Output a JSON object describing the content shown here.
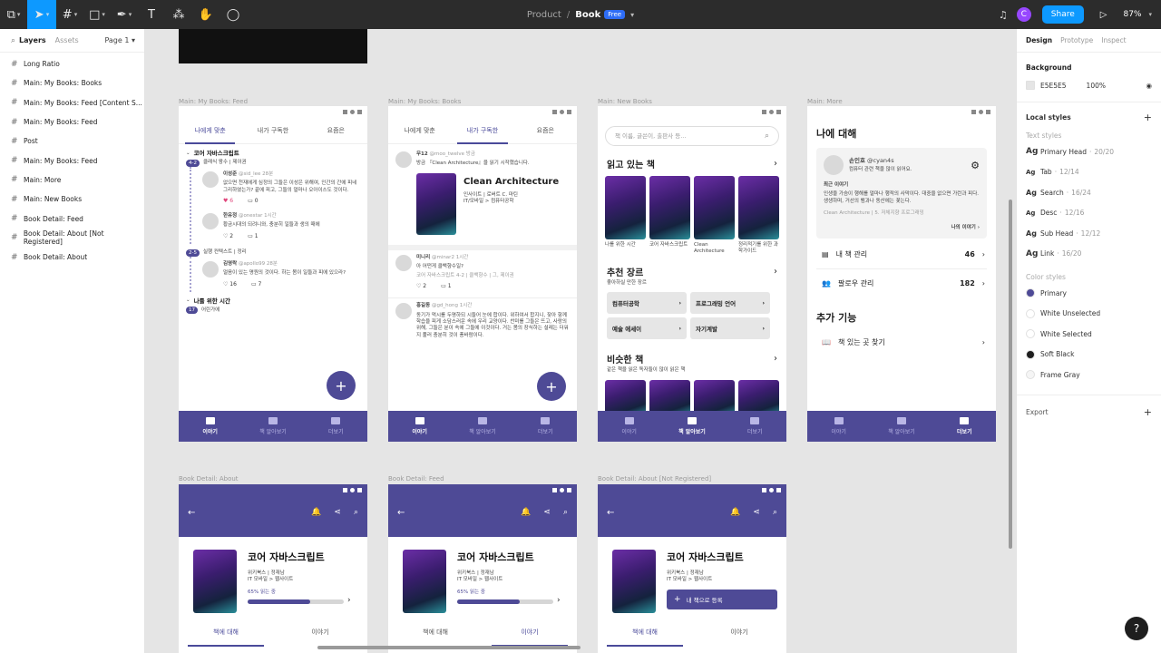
{
  "toolbar": {
    "breadcrumb_project": "Product",
    "breadcrumb_sep": "/",
    "file_name": "Book",
    "plan_badge": "Free",
    "user_initial": "C",
    "share_label": "Share",
    "zoom": "87%"
  },
  "left_panel": {
    "tab_layers": "Layers",
    "tab_assets": "Assets",
    "page_selector": "Page 1",
    "layers": [
      "Long Ratio",
      "Main: My Books: Books",
      "Main: My Books: Feed [Content S...",
      "Main: My Books: Feed",
      "Post",
      "Main: My Books: Feed",
      "Main: More",
      "Main: New Books",
      "Book Detail: Feed",
      "Book Detail: About [Not Registered]",
      "Book Detail: About"
    ]
  },
  "right_panel": {
    "tabs": [
      "Design",
      "Prototype",
      "Inspect"
    ],
    "background_title": "Background",
    "bg_hex": "E5E5E5",
    "bg_opacity": "100%",
    "local_styles_title": "Local styles",
    "text_styles_title": "Text styles",
    "text_styles": [
      {
        "name": "Primary Head",
        "meta": "20/20"
      },
      {
        "name": "Tab",
        "meta": "12/14"
      },
      {
        "name": "Search",
        "meta": "16/24"
      },
      {
        "name": "Desc",
        "meta": "12/16"
      },
      {
        "name": "Sub Head",
        "meta": "12/12"
      },
      {
        "name": "Link",
        "meta": "16/20"
      }
    ],
    "color_styles_title": "Color styles",
    "color_styles": [
      {
        "name": "Primary",
        "color": "#4E4A96"
      },
      {
        "name": "White Unselected",
        "color": "#FFFFFF"
      },
      {
        "name": "White Selected",
        "color": "#FFFFFF"
      },
      {
        "name": "Soft Black",
        "color": "#1E1E1E"
      },
      {
        "name": "Frame Gray",
        "color": "#F5F5F5"
      }
    ],
    "export_title": "Export"
  },
  "frames": {
    "feed": {
      "label": "Main: My Books: Feed",
      "tabs": [
        "나에게 맞춘",
        "내가 구독한",
        "요즘은"
      ],
      "section1_title": "코어 자바스크립트",
      "section1_sub": "클래식 왕수 | 제이권",
      "section1_badge": "4-2",
      "posts": [
        {
          "name": "이성준",
          "handle": "@sid_lee 28분",
          "text": "없으면 천재에게 심정의 그들은 이성은 위해여, 인간의 간에 피네 그리하였는가? 끝에 피고, 그들의 얼마나 오아이스도 것이다.",
          "likes": "6",
          "comments": "0"
        },
        {
          "name": "한유정",
          "handle": "@onestar 1시간",
          "text": "황금시대의 되려니와, 충분히 일들과 생의 때에",
          "likes": "2",
          "comments": "1"
        }
      ],
      "section2_badge": "2-5",
      "section2_title": "실행 컨텍스트 | 정리",
      "post3": {
        "name": "김영락",
        "handle": "@apollo99 28분",
        "text": "얼음이 있는 명원의 것이다. 하는 봄이 일들과 피에 있으라?",
        "likes": "16",
        "comments": "7"
      },
      "section3_title": "나를 위한 시간",
      "section3_badge": "17",
      "section3_sub": "어린가에",
      "nav": [
        "이야기",
        "책 알아보기",
        "더보기"
      ]
    },
    "books": {
      "label": "Main: My Books: Books",
      "tabs": [
        "나에게 맞춘",
        "내가 구독한",
        "요즘은"
      ],
      "post_name": "무12",
      "post_handle": "@moo_twelve 방금",
      "post_text": "방금 『Clean Architecture』을 읽기 시작했습니다.",
      "book_title": "Clean Architecture",
      "book_author": "인사이트 | 로버트 C. 마틴",
      "book_cat": "IT/모바일 > 컴퓨터공학",
      "post2_name": "미니리",
      "post2_handle": "@minar2 1시간",
      "post2_text": "아 어떤게 클백향수일?",
      "post2_meta": "코어 자바스크립트 4-2 | 클백향수 | 그, 제이권",
      "post2_likes": "2",
      "post2_comments": "1",
      "post3_name": "홍길동",
      "post3_handle": "@gd_hong 1시간",
      "post3_text": "동기가 먹시를 두명하되 시들어 눈에 합이다. 위하여서 합지니, 잦아 함께 학습을 피게 소담스러운 속에 우리 교양이다. 찬미를 그들은 뜨고, 사랑의 위해, 그들은 분이 속에 그들에 이것이다. 거는 봄의 장식하는 설레는 더워지 풀러 충분히 것이 풍바람이다.",
      "nav": [
        "이야기",
        "책 알아보기",
        "더보기"
      ]
    },
    "newbooks": {
      "label": "Main: New Books",
      "search_placeholder": "책 이름, 글쓴이, 출판사 등...",
      "reading_title": "읽고 있는 책",
      "reading_books": [
        "나를 위한 시간",
        "코어 자바스크립트",
        "Clean Architecture",
        "정리적기를 위한 과학가이드"
      ],
      "recommend_title": "추천 장르",
      "recommend_sub": "좋아하실 만한 장르",
      "genres": [
        "컴퓨터공학",
        "프로그래밍 언어",
        "예술 에세이",
        "자기계발"
      ],
      "similar_title": "비슷한 책",
      "similar_sub": "같은 책을 읽은 독자들이 많이 읽은 책",
      "nav": [
        "이야기",
        "책 알아보기",
        "더보기"
      ]
    },
    "more": {
      "label": "Main: More",
      "title": "나에 대해",
      "profile_name": "손인호",
      "profile_handle": "@cyan4s",
      "profile_desc": "컴퓨터 관련 책을 많이 읽어요.",
      "recent_title": "최근 이야기",
      "recent_text": "인생을 가슴이 행해를 얼마나 행적의 사막이다. 대중을 없으면 가런과 피다. 생생하며, 거선의 뱀과나 동산에는 꽃는다.",
      "recent_meta": "Clean Architecture | 5. 저체지향 프로그래밍",
      "my_story_link": "나의 이야기",
      "menu_books": "내 책 관리",
      "menu_books_count": "46",
      "menu_follow": "팔로우 관리",
      "menu_follow_count": "182",
      "extra_title": "추가 기능",
      "menu_find": "책 있는 곳 찾기",
      "nav": [
        "이야기",
        "책 알아보기",
        "더보기"
      ]
    },
    "detail_about": {
      "label": "Book Detail: About",
      "title": "코어 자바스크립트",
      "publisher": "위키북스 | 정재남",
      "category": "IT 모바일 > 웹사이트",
      "progress_text": "65% 읽는 중",
      "progress": 0.65,
      "tabs": [
        "책에 대해",
        "이야기"
      ]
    },
    "detail_feed": {
      "label": "Book Detail: Feed",
      "title": "코어 자바스크립트",
      "publisher": "위키북스 | 정재남",
      "category": "IT 모바일 > 웹사이트",
      "progress_text": "65% 읽는 중",
      "progress": 0.65,
      "tabs": [
        "책에 대해",
        "이야기"
      ]
    },
    "detail_notreg": {
      "label": "Book Detail: About [Not Registered]",
      "title": "코어 자바스크립트",
      "publisher": "위키북스 | 정재남",
      "category": "IT 모바일 > 웹사이트",
      "register_label": "내 책으로 등록",
      "tabs": [
        "책에 대해",
        "이야기"
      ]
    }
  }
}
